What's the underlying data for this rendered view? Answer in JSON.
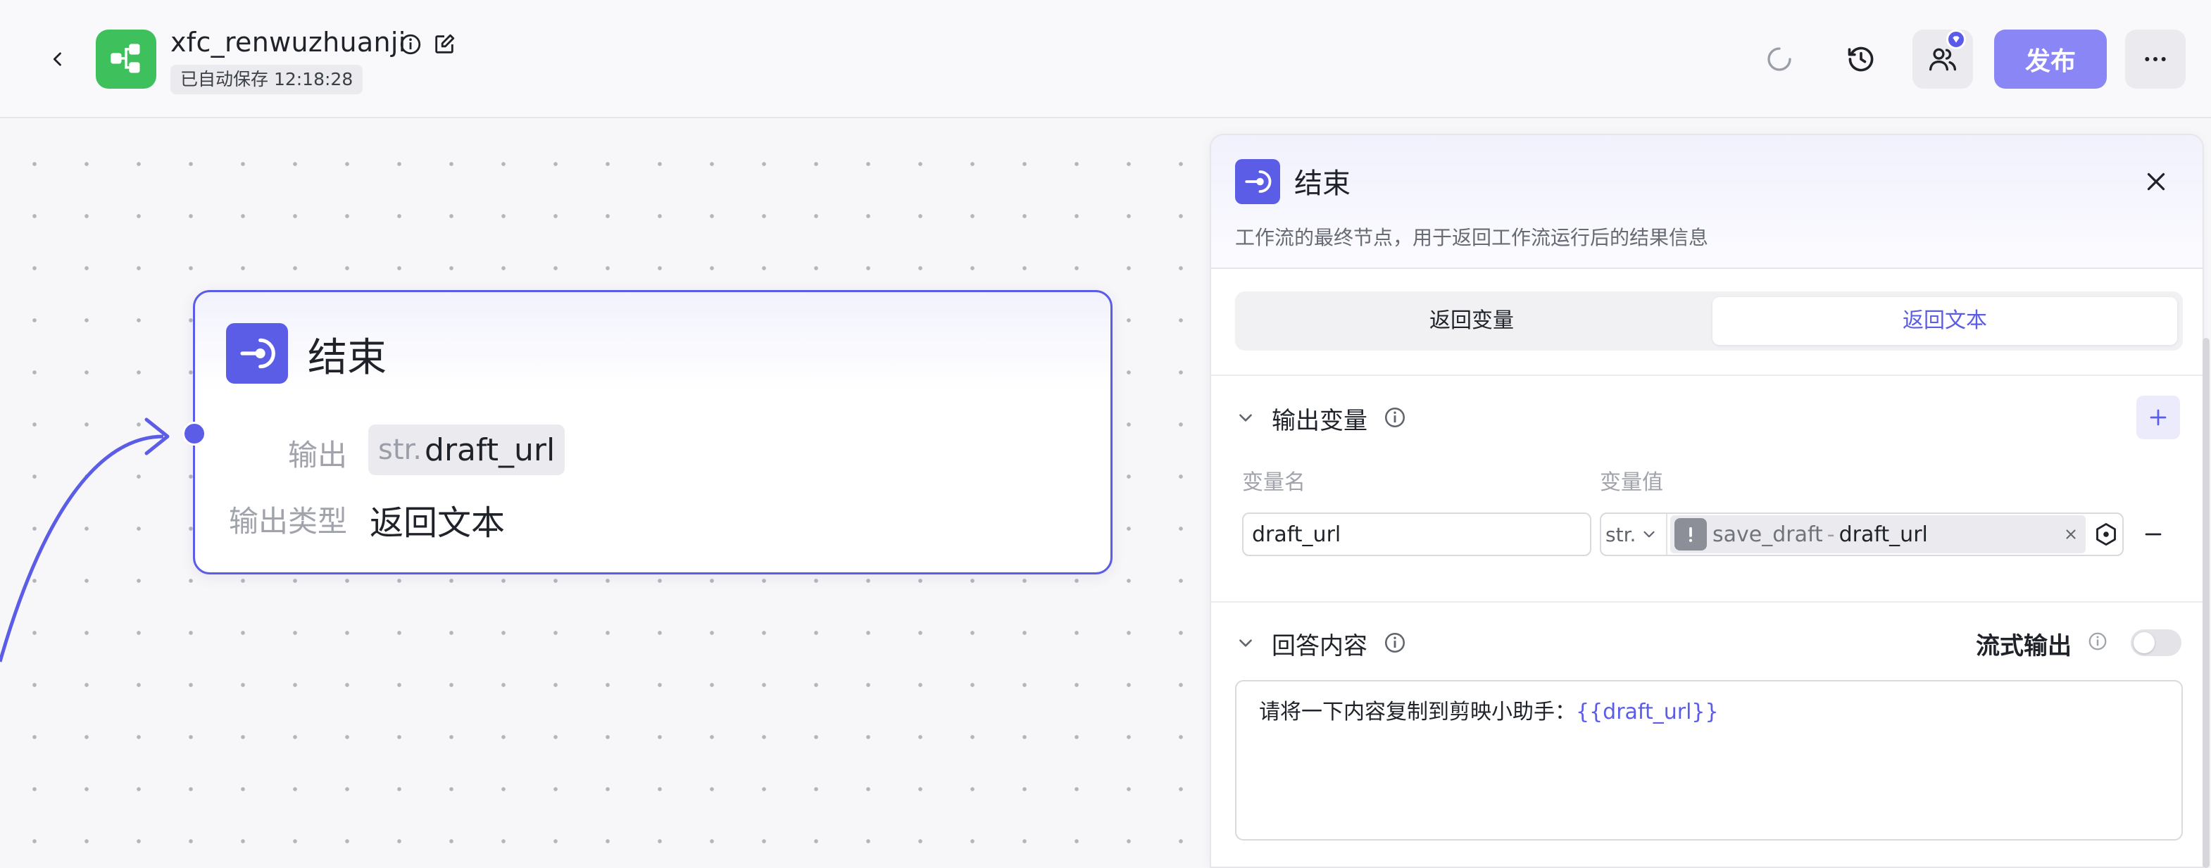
{
  "header": {
    "app_name": "xfc_renwuzhuanji",
    "autosave_text": "已自动保存 12:18:28",
    "publish_label": "发布",
    "brand_color": "#3ec15c",
    "accent_color": "#5b5de6",
    "icons": {
      "back": "chevron-left-icon",
      "app": "workflow-icon",
      "info": "info-icon",
      "edit": "edit-icon",
      "loading": "loading-icon",
      "history": "history-icon",
      "collaborators": "users-icon",
      "more": "more-icon"
    }
  },
  "canvas": {
    "node": {
      "title": "结束",
      "output_label": "输出",
      "output_type_tag": "str.",
      "output_var": "draft_url",
      "output_type_label": "输出类型",
      "output_type_value": "返回文本"
    }
  },
  "panel": {
    "title": "结束",
    "description": "工作流的最终节点，用于返回工作流运行后的结果信息",
    "tabs": [
      {
        "label": "返回变量",
        "active": false
      },
      {
        "label": "返回文本",
        "active": true
      }
    ],
    "output_section": {
      "title": "输出变量",
      "col_name": "变量名",
      "col_value": "变量值",
      "rows": [
        {
          "name": "draft_url",
          "type": "str.",
          "ref_node": "save_draft",
          "ref_separator": "-",
          "ref_var": "draft_url"
        }
      ]
    },
    "answer_section": {
      "title": "回答内容",
      "stream_label": "流式输出",
      "stream_enabled": false,
      "content_prefix": "请将一下内容复制到剪映小助手：",
      "content_var": "{{draft_url}}"
    }
  }
}
